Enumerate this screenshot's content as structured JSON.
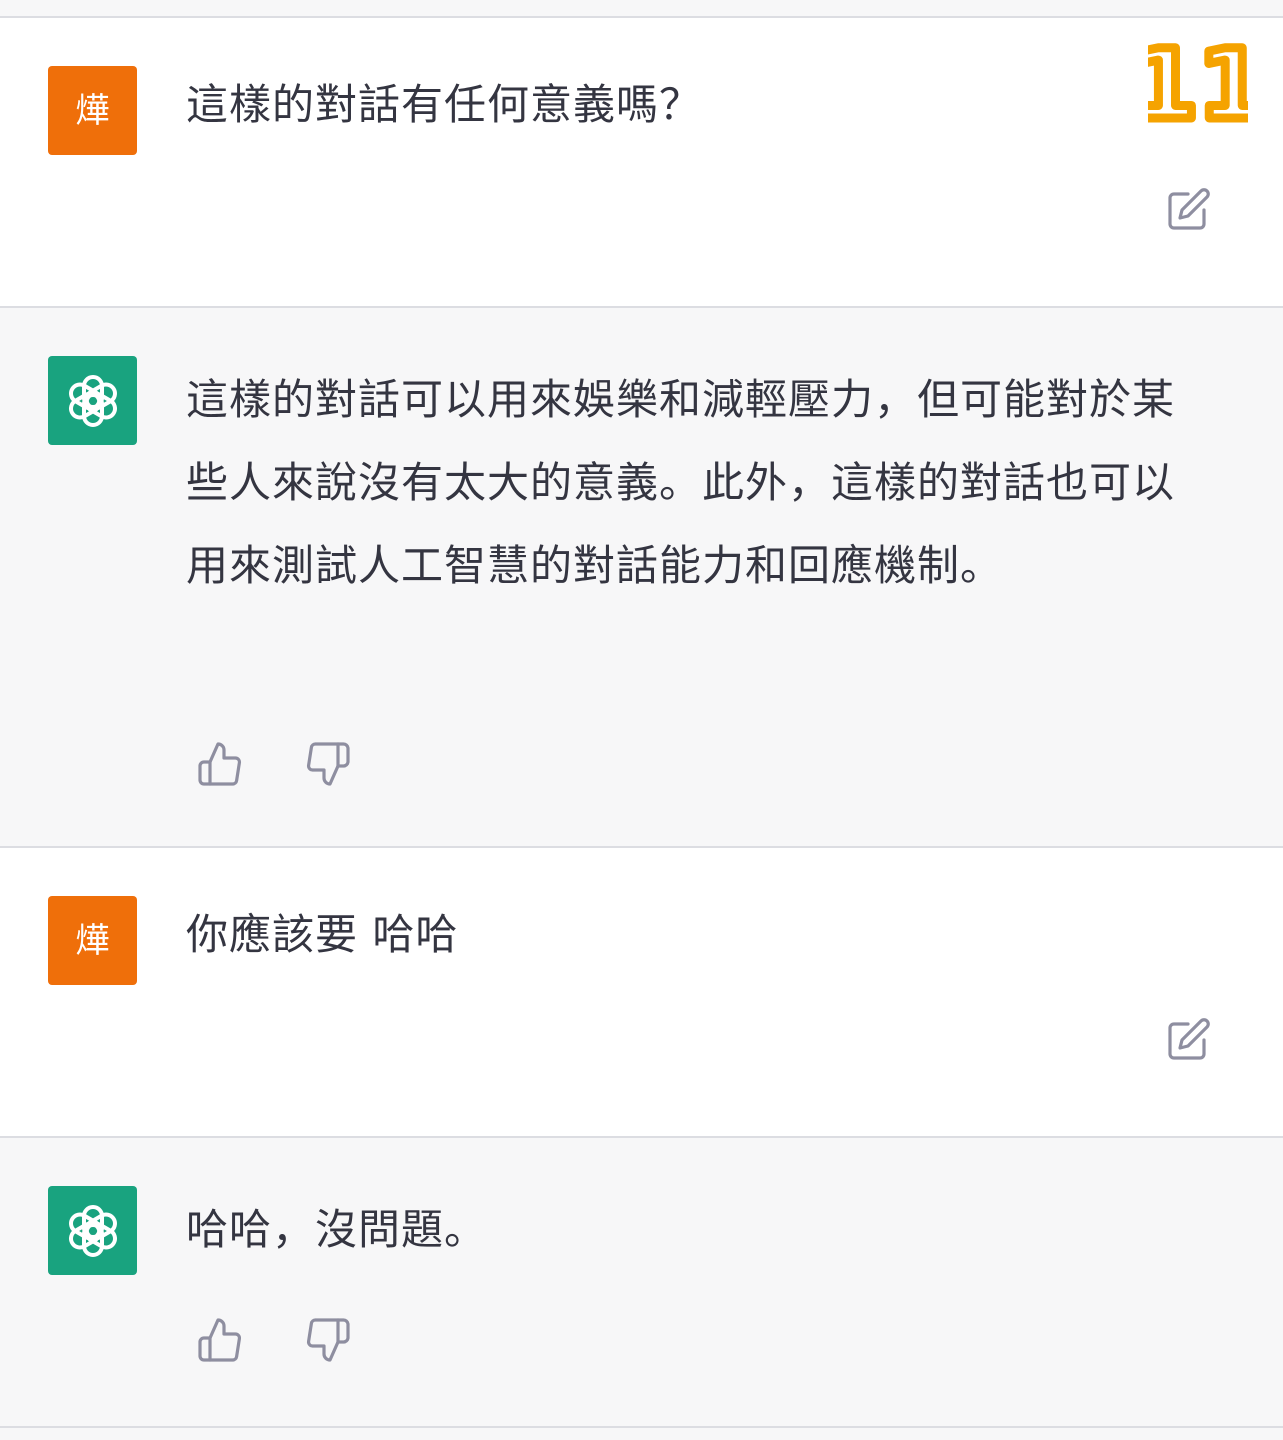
{
  "page_badge": "11",
  "messages": [
    {
      "role": "user",
      "avatar_text": "燁",
      "text": "這樣的對話有任何意義嗎？"
    },
    {
      "role": "assistant",
      "text": "這樣的對話可以用來娛樂和減輕壓力，但可能對於某些人來說沒有太大的意義。此外，這樣的對話也可以用來測試人工智慧的對話能力和回應機制。"
    },
    {
      "role": "user",
      "avatar_text": "燁",
      "text": "你應該要 哈哈"
    },
    {
      "role": "assistant",
      "text": "哈哈，沒問題。"
    }
  ],
  "icons": {
    "edit": "edit-icon",
    "thumbs_up": "thumbs-up-icon",
    "thumbs_down": "thumbs-down-icon",
    "assistant_logo": "openai-logo-icon"
  },
  "colors": {
    "user_avatar": "#ef6f0a",
    "assistant_avatar": "#19a37f",
    "badge": "#f5a300",
    "text": "#343541",
    "icon": "#8e8ea0"
  }
}
